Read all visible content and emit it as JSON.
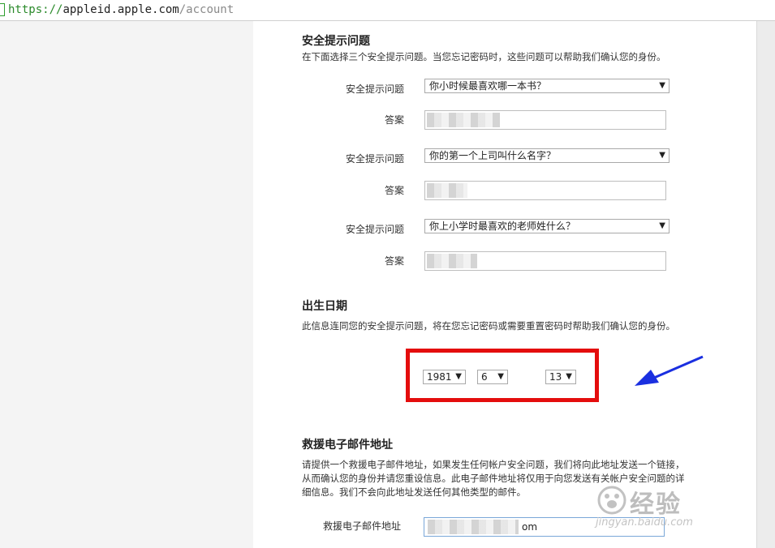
{
  "browser": {
    "url_scheme": "https://",
    "url_host": "appleid.apple.com",
    "url_path": "/account"
  },
  "security": {
    "title": "安全提示问题",
    "description": "在下面选择三个安全提示问题。当您忘记密码时，这些问题可以帮助我们确认您的身份。",
    "question_label": "安全提示问题",
    "answer_label": "答案",
    "questions": [
      "你小时候最喜欢哪一本书？",
      "你的第一个上司叫什么名字？",
      "你上小学时最喜欢的老师姓什么？"
    ]
  },
  "birthday": {
    "title": "出生日期",
    "description": "此信息连同您的安全提示问题，将在您忘记密码或需要重置密码时帮助我们确认您的身份。",
    "year": "1981",
    "month": "6",
    "day": "13"
  },
  "rescue": {
    "title": "救援电子邮件地址",
    "description": "请提供一个救援电子邮件地址，如果发生任何帐户安全问题，我们将向此地址发送一个链接，从而确认您的身份并请您重设信息。此电子邮件地址将仅用于向您发送有关帐户安全问题的详细信息。我们不会向此地址发送任何其他类型的邮件。",
    "email_label": "救援电子邮件地址",
    "email_value_visible": "om"
  },
  "watermark": {
    "brand": "经验",
    "url": "jingyan.baidu.com"
  },
  "colors": {
    "highlight": "#e40d0d",
    "annotation_arrow": "#1a2fe0",
    "url_scheme": "#2a8a2a"
  },
  "icons": {
    "dropdown": "▼"
  }
}
